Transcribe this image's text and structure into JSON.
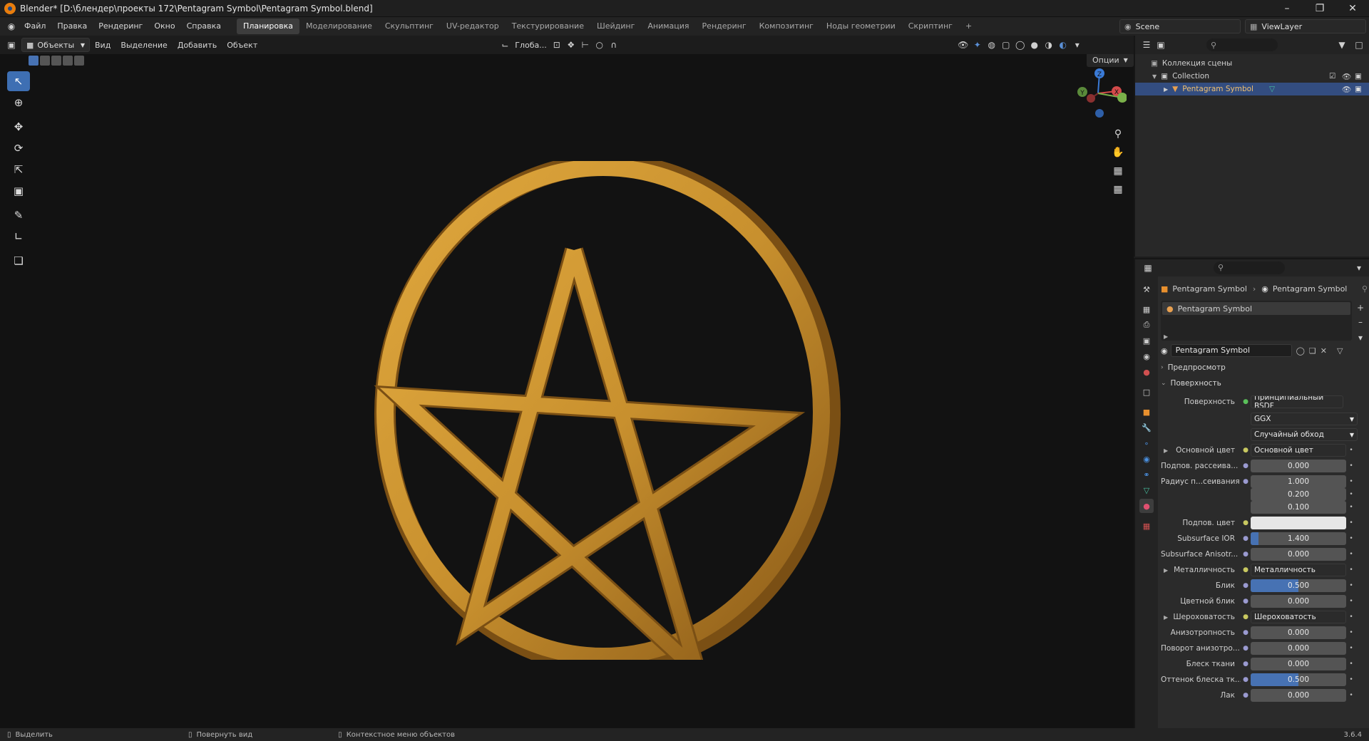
{
  "window": {
    "title": "Blender* [D:\\блендер\\проекты 172\\Pentagram Symbol\\Pentagram Symbol.blend]",
    "controls": [
      "minimize-icon",
      "maximize-icon",
      "close-icon"
    ]
  },
  "menu": {
    "items": [
      "Файл",
      "Правка",
      "Рендеринг",
      "Окно",
      "Справка"
    ],
    "workspaces": [
      "Планировка",
      "Моделирование",
      "Скульптинг",
      "UV-редактор",
      "Текстурирование",
      "Шейдинг",
      "Анимация",
      "Рендеринг",
      "Композитинг",
      "Ноды геометрии",
      "Скриптинг"
    ],
    "active_workspace": "Планировка",
    "add_tab": "+",
    "scene": "Scene",
    "view_layer": "ViewLayer"
  },
  "viewport_header": {
    "mode": "Объекты",
    "menus": [
      "Вид",
      "Выделение",
      "Добавить",
      "Объект"
    ],
    "orientation": "Глоба...",
    "options": "Опции"
  },
  "tools": [
    "select-box-icon",
    "cursor-icon",
    "move-icon",
    "rotate-icon",
    "scale-icon",
    "transform-icon",
    "annotate-icon",
    "measure-icon",
    "add-cube-icon"
  ],
  "gizmo": {
    "x": "X",
    "y": "Y",
    "z": "Z"
  },
  "outliner": {
    "root": "Коллекция сцены",
    "collection": "Collection",
    "object": "Pentagram Symbol"
  },
  "properties": {
    "breadcrumb_object": "Pentagram Symbol",
    "breadcrumb_material": "Pentagram Symbol",
    "slot_name": "Pentagram Symbol",
    "material_name": "Pentagram Symbol",
    "panel_preview": "Предпросмотр",
    "panel_surface": "Поверхность",
    "surface_label": "Поверхность",
    "surface_shader": "Принципиальный BSDF",
    "distribution": "GGX",
    "subsurface_method": "Случайный обход",
    "rows": [
      {
        "label": "Основной цвет",
        "value": "Основной цвет",
        "kind": "link",
        "expand": true
      },
      {
        "label": "Подпов. рассеива...",
        "value": "0.000",
        "kind": "num",
        "fill": 0
      },
      {
        "label": "Радиус п...сеивания",
        "value": "1.000",
        "kind": "num",
        "fill": 0
      },
      {
        "label": "",
        "value": "0.200",
        "kind": "num",
        "fill": 0
      },
      {
        "label": "",
        "value": "0.100",
        "kind": "num",
        "fill": 0
      },
      {
        "label": "Подпов. цвет",
        "value": "",
        "kind": "color",
        "color": "#e6e6e6"
      },
      {
        "label": "Subsurface IOR",
        "value": "1.400",
        "kind": "num",
        "fill": 0.08
      },
      {
        "label": "Subsurface Anisotr...",
        "value": "0.000",
        "kind": "num",
        "fill": 0
      },
      {
        "label": "Металличность",
        "value": "Металличность",
        "kind": "link",
        "expand": true
      },
      {
        "label": "Блик",
        "value": "0.500",
        "kind": "num",
        "fill": 0.5
      },
      {
        "label": "Цветной блик",
        "value": "0.000",
        "kind": "num",
        "fill": 0
      },
      {
        "label": "Шероховатость",
        "value": "Шероховатость",
        "kind": "link",
        "expand": true
      },
      {
        "label": "Анизотропность",
        "value": "0.000",
        "kind": "num",
        "fill": 0
      },
      {
        "label": "Поворот анизотро...",
        "value": "0.000",
        "kind": "num",
        "fill": 0
      },
      {
        "label": "Блеск ткани",
        "value": "0.000",
        "kind": "num",
        "fill": 0
      },
      {
        "label": "Оттенок блеска тк...",
        "value": "0.500",
        "kind": "num",
        "fill": 0.5
      },
      {
        "label": "Лак",
        "value": "0.000",
        "kind": "num",
        "fill": 0
      }
    ]
  },
  "status": {
    "select": "Выделить",
    "rotate": "Повернуть вид",
    "context": "Контекстное меню объектов",
    "version": "3.6.4"
  },
  "colors": {
    "accent": "#4772b3",
    "selected_row": "#334d80",
    "pentagram": "#c8902e"
  }
}
